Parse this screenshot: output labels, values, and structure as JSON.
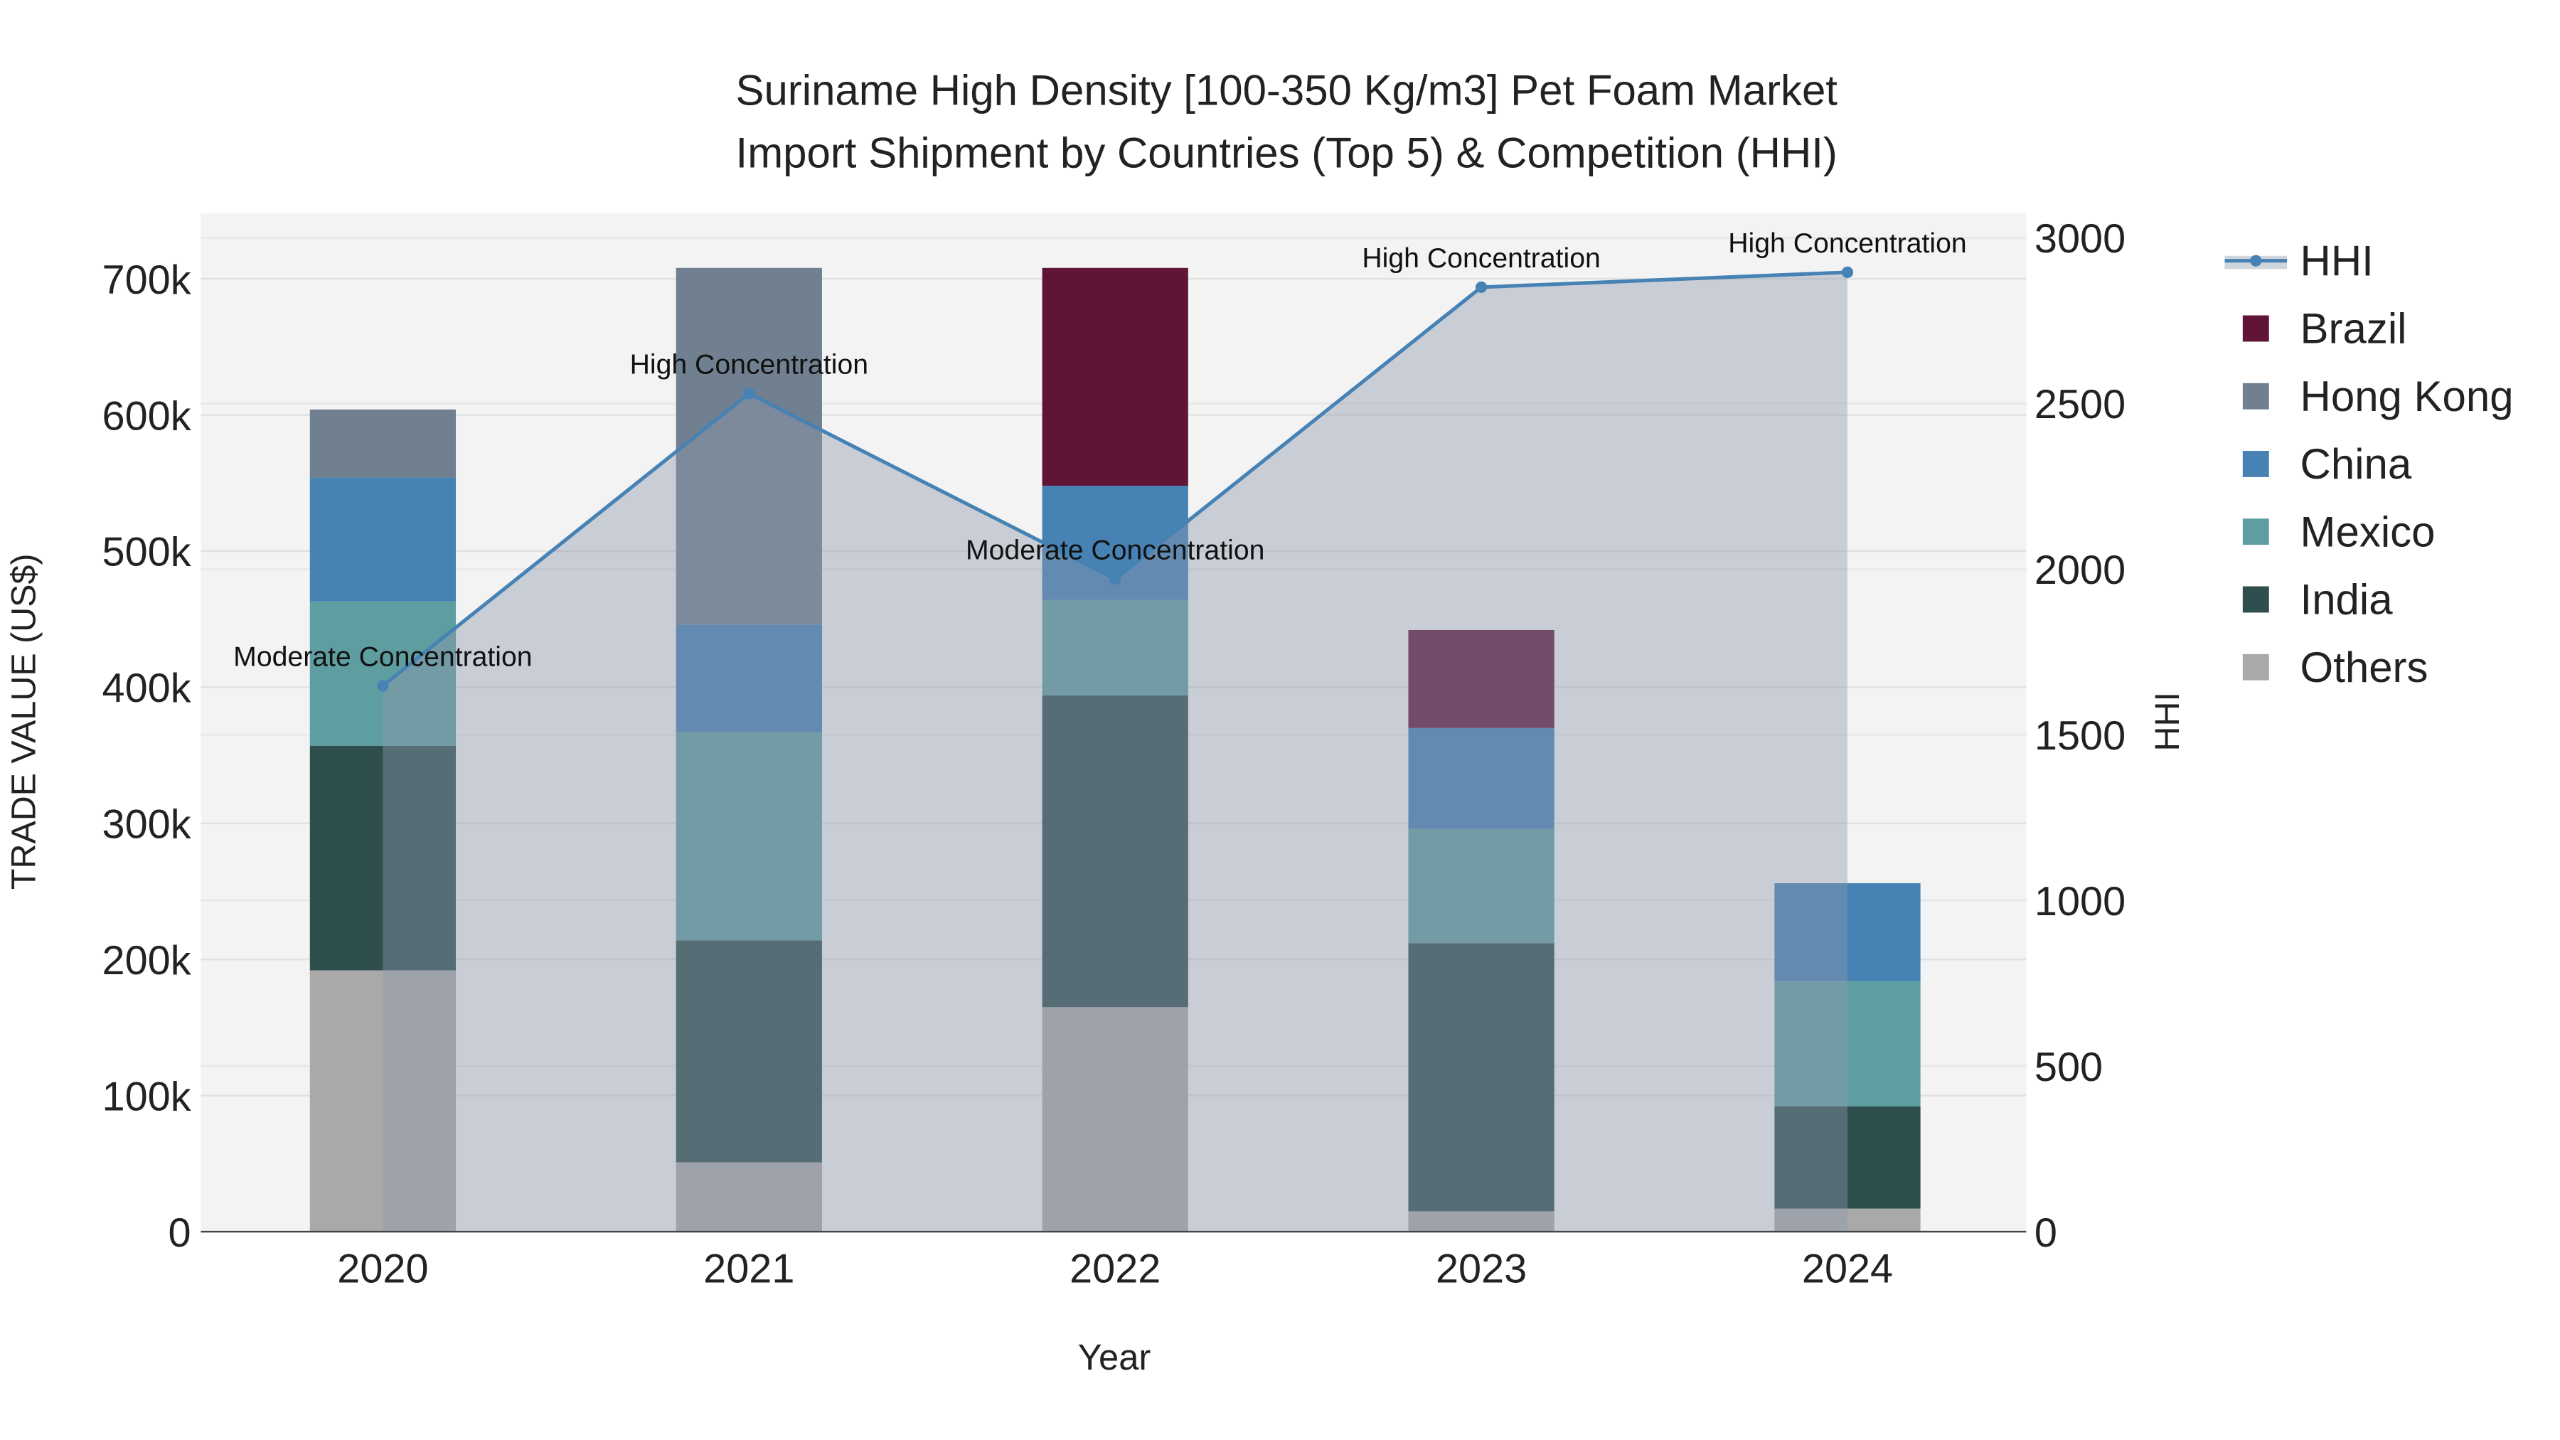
{
  "chart_data": {
    "type": "bar",
    "title": [
      "Suriname High Density [100-350 Kg/m3] Pet Foam Market",
      "Import Shipment by Countries (Top 5) & Competition (HHI)"
    ],
    "xlabel": "Year",
    "ylabel": "TRADE VALUE (US$)",
    "y2label": "HHI",
    "categories": [
      "2020",
      "2021",
      "2022",
      "2023",
      "2024"
    ],
    "ylim": [
      0,
      745000
    ],
    "y2lim": [
      0,
      3050
    ],
    "yticks": [
      0,
      100000,
      200000,
      300000,
      400000,
      500000,
      600000,
      700000
    ],
    "ytick_labels": [
      "0",
      "100k",
      "200k",
      "300k",
      "400k",
      "500k",
      "600k",
      "700k"
    ],
    "y2ticks": [
      0,
      500,
      1000,
      1500,
      2000,
      2500,
      3000
    ],
    "y2tick_labels": [
      "0",
      "500",
      "1000",
      "1500",
      "2000",
      "2500",
      "3000"
    ],
    "stack_order": [
      "Others",
      "India",
      "Mexico",
      "China",
      "Hong Kong",
      "Brazil"
    ],
    "series": [
      {
        "name": "Others",
        "color": "#a9a9a9",
        "values": [
          192000,
          51000,
          165000,
          15000,
          17000
        ]
      },
      {
        "name": "India",
        "color": "#2f4f4f",
        "values": [
          165000,
          163000,
          229000,
          197000,
          75000
        ]
      },
      {
        "name": "Mexico",
        "color": "#5f9ea0",
        "values": [
          106000,
          153000,
          70000,
          84000,
          92000
        ]
      },
      {
        "name": "China",
        "color": "#4682b4",
        "values": [
          91000,
          79000,
          84000,
          74000,
          72000
        ]
      },
      {
        "name": "Hong Kong",
        "color": "#708090",
        "values": [
          50000,
          262000,
          0,
          0,
          0
        ]
      },
      {
        "name": "Brazil",
        "color": "#601436",
        "values": [
          0,
          0,
          160000,
          72000,
          0
        ]
      }
    ],
    "hhi": {
      "name": "HHI",
      "color": "#4682b4",
      "values": [
        1648,
        2530,
        1970,
        2851,
        2896
      ],
      "annotations": [
        "Moderate Concentration",
        "High Concentration",
        "Moderate Concentration",
        "High Concentration",
        "High Concentration"
      ]
    },
    "legend": [
      "HHI",
      "Brazil",
      "Hong Kong",
      "China",
      "Mexico",
      "India",
      "Others"
    ],
    "legend_position": "right",
    "grid": true
  }
}
